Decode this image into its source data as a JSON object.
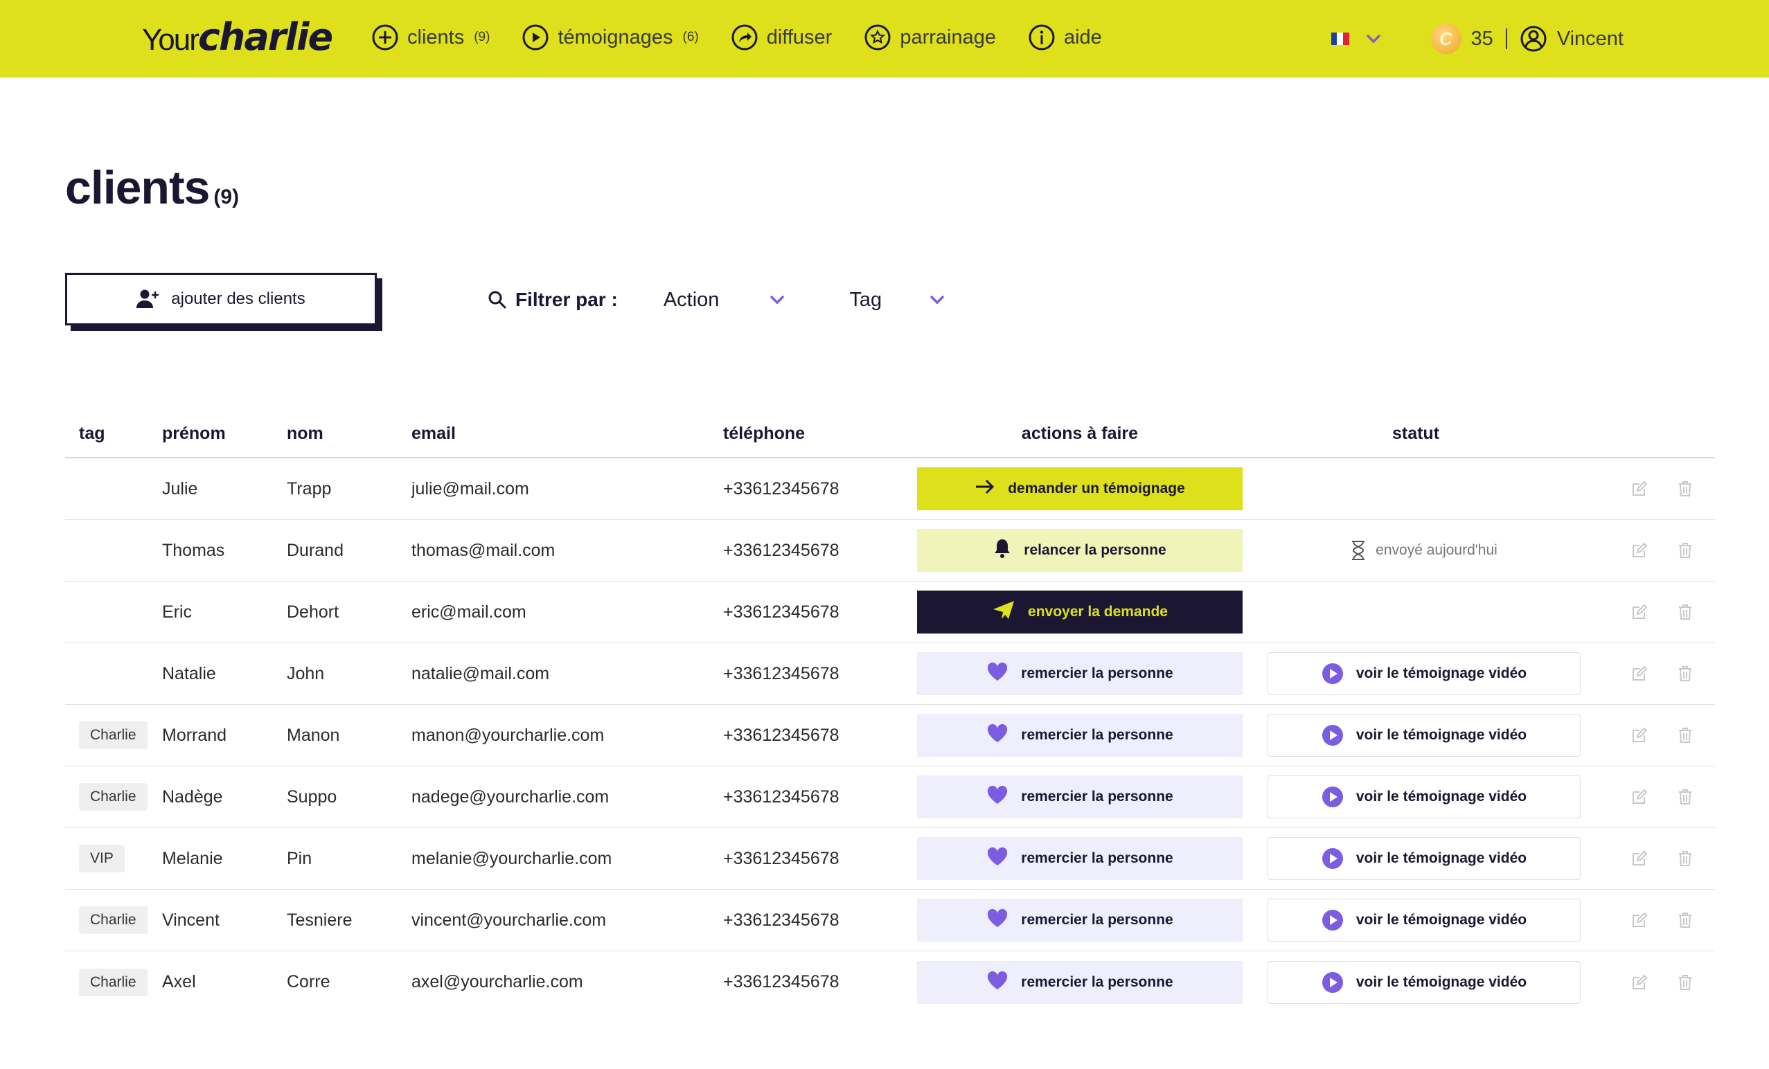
{
  "header": {
    "logo": {
      "part1": "Your",
      "part2": "charlie"
    },
    "nav": [
      {
        "label": "clients",
        "count": "(9)",
        "icon": "plus-circle-icon"
      },
      {
        "label": "témoignages",
        "count": "(6)",
        "icon": "play-circle-icon"
      },
      {
        "label": "diffuser",
        "count": "",
        "icon": "share-circle-icon"
      },
      {
        "label": "parrainage",
        "count": "",
        "icon": "star-badge-icon"
      },
      {
        "label": "aide",
        "count": "",
        "icon": "info-circle-icon"
      }
    ],
    "language": "FR",
    "credits": "35",
    "user_name": "Vincent",
    "colors": {
      "brand": "#dde01a",
      "dark": "#1b1733",
      "accent": "#7c5ce0"
    }
  },
  "page": {
    "title": "clients",
    "count": "(9)",
    "add_button": "ajouter des clients",
    "filter_label": "Filtrer par :",
    "filter_action": "Action",
    "filter_tag": "Tag"
  },
  "table": {
    "columns": [
      "tag",
      "prénom",
      "nom",
      "email",
      "téléphone",
      "actions à faire",
      "statut"
    ],
    "rows": [
      {
        "tag": "",
        "first": "Julie",
        "last": "Trapp",
        "email": "julie@mail.com",
        "phone": "+33612345678",
        "action": "demander un témoignage",
        "action_type": "demander",
        "status": "",
        "status_type": "none"
      },
      {
        "tag": "",
        "first": "Thomas",
        "last": "Durand",
        "email": "thomas@mail.com",
        "phone": "+33612345678",
        "action": "relancer la personne",
        "action_type": "relancer",
        "status": "envoyé aujourd'hui",
        "status_type": "text"
      },
      {
        "tag": "",
        "first": "Eric",
        "last": "Dehort",
        "email": "eric@mail.com",
        "phone": "+33612345678",
        "action": "envoyer la demande",
        "action_type": "envoyer",
        "status": "",
        "status_type": "none"
      },
      {
        "tag": "",
        "first": "Natalie",
        "last": "John",
        "email": "natalie@mail.com",
        "phone": "+33612345678",
        "action": "remercier la personne",
        "action_type": "remercier",
        "status": "voir le témoignage vidéo",
        "status_type": "button"
      },
      {
        "tag": "Charlie",
        "first": "Morrand",
        "last": "Manon",
        "email": "manon@yourcharlie.com",
        "phone": "+33612345678",
        "action": "remercier la personne",
        "action_type": "remercier",
        "status": "voir le témoignage vidéo",
        "status_type": "button"
      },
      {
        "tag": "Charlie",
        "first": "Nadège",
        "last": "Suppo",
        "email": "nadege@yourcharlie.com",
        "phone": "+33612345678",
        "action": "remercier la personne",
        "action_type": "remercier",
        "status": "voir le témoignage vidéo",
        "status_type": "button"
      },
      {
        "tag": "VIP",
        "first": "Melanie",
        "last": "Pin",
        "email": "melanie@yourcharlie.com",
        "phone": "+33612345678",
        "action": "remercier la personne",
        "action_type": "remercier",
        "status": "voir le témoignage vidéo",
        "status_type": "button"
      },
      {
        "tag": "Charlie",
        "first": "Vincent",
        "last": "Tesniere",
        "email": "vincent@yourcharlie.com",
        "phone": "+33612345678",
        "action": "remercier la personne",
        "action_type": "remercier",
        "status": "voir le témoignage vidéo",
        "status_type": "button"
      },
      {
        "tag": "Charlie",
        "first": "Axel",
        "last": "Corre",
        "email": "axel@yourcharlie.com",
        "phone": "+33612345678",
        "action": "remercier la personne",
        "action_type": "remercier",
        "status": "voir le témoignage vidéo",
        "status_type": "button"
      }
    ]
  }
}
